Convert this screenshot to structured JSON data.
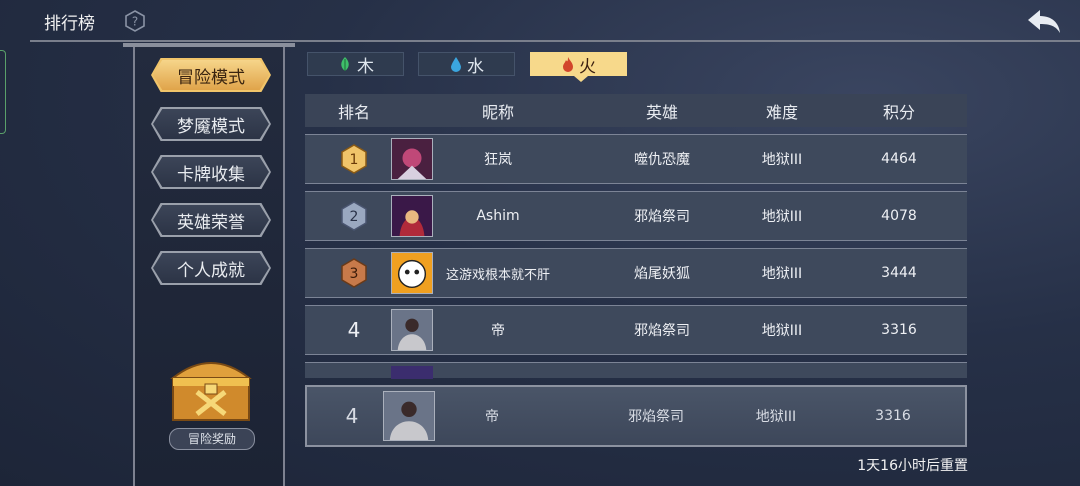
{
  "header": {
    "title": "排行榜"
  },
  "modes": [
    {
      "label": "冒险模式",
      "active": true
    },
    {
      "label": "梦魇模式",
      "active": false
    },
    {
      "label": "卡牌收集",
      "active": false
    },
    {
      "label": "英雄荣誉",
      "active": false
    },
    {
      "label": "个人成就",
      "active": false
    }
  ],
  "reward": {
    "label": "冒险奖励"
  },
  "element_tabs": [
    {
      "label": "木",
      "icon": "leaf-icon",
      "color": "#3fbf6a"
    },
    {
      "label": "水",
      "icon": "water-drop-icon",
      "color": "#3ba6e0"
    },
    {
      "label": "火",
      "icon": "fire-icon",
      "color": "#d2452b",
      "active": true
    }
  ],
  "table": {
    "headers": {
      "rank": "排名",
      "name": "昵称",
      "hero": "英雄",
      "difficulty": "难度",
      "score": "积分"
    },
    "rows": [
      {
        "rank": "1",
        "name": "狂岚",
        "hero": "噬仇恐魔",
        "difficulty": "地狱III",
        "score": "4464"
      },
      {
        "rank": "2",
        "name": "Ashim",
        "hero": "邪焰祭司",
        "difficulty": "地狱III",
        "score": "4078"
      },
      {
        "rank": "3",
        "name": "这游戏根本就不肝",
        "hero": "焰尾妖狐",
        "difficulty": "地狱III",
        "score": "3444"
      },
      {
        "rank": "4",
        "name": "帝",
        "hero": "邪焰祭司",
        "difficulty": "地狱III",
        "score": "3316"
      }
    ]
  },
  "my_rank": {
    "rank": "4",
    "name": "帝",
    "hero": "邪焰祭司",
    "difficulty": "地狱III",
    "score": "3316"
  },
  "reset_text": "1天16小时后重置",
  "colors": {
    "gold": "#f0c46a",
    "silver": "#9aa8c0",
    "bronze": "#c87a4a",
    "accent": "#f7d98b"
  }
}
